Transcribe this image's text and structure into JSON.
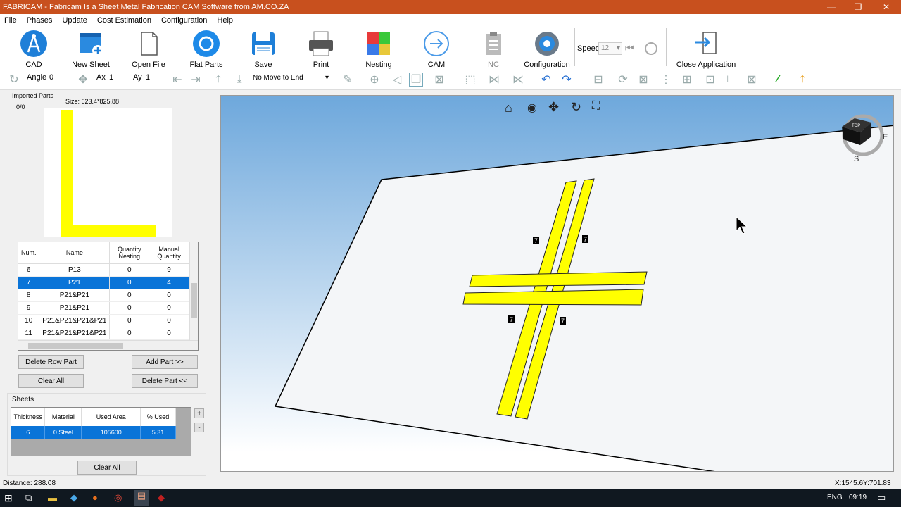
{
  "window": {
    "title": "FABRICAM - Fabricam Is a Sheet Metal Fabrication CAM Software from AM.CO.ZA"
  },
  "menu": [
    "File",
    "Phases",
    "Update",
    "Cost Estimation",
    "Configuration",
    "Help"
  ],
  "toolbar": {
    "cad": "CAD",
    "new_sheet": "New Sheet",
    "open_file": "Open File",
    "flat_parts": "Flat Parts",
    "save": "Save",
    "print": "Print",
    "nesting": "Nesting",
    "cam": "CAM",
    "nc": "NC",
    "configuration": "Configuration",
    "speed_label": "Speed",
    "speed_value": "12",
    "close_application": "Close Application"
  },
  "toolbar2": {
    "angle_label": "Angle",
    "angle_value": "0",
    "ax_label": "Ax",
    "ax_value": "1",
    "ay_label": "Ay",
    "ay_value": "1",
    "move_dropdown": "No Move to End"
  },
  "imported_parts": {
    "label": "Imported Parts",
    "count": "0/0",
    "size": "Size: 623.4*825.88"
  },
  "parts_table": {
    "headers": [
      "Num.",
      "Name",
      "Quantity Nesting",
      "Manual Quantity"
    ],
    "rows": [
      {
        "num": "6",
        "name": "P13",
        "qn": "0",
        "mq": "9"
      },
      {
        "num": "7",
        "name": "P21",
        "qn": "0",
        "mq": "4"
      },
      {
        "num": "8",
        "name": "P21&P21",
        "qn": "0",
        "mq": "0"
      },
      {
        "num": "9",
        "name": "P21&P21",
        "qn": "0",
        "mq": "0"
      },
      {
        "num": "10",
        "name": "P21&P21&P21&P21",
        "qn": "0",
        "mq": "0"
      },
      {
        "num": "11",
        "name": "P21&P21&P21&P21",
        "qn": "0",
        "mq": "0"
      }
    ],
    "selected_row": 1
  },
  "buttons": {
    "delete_row_part": "Delete Row Part",
    "add_part": "Add Part >>",
    "clear_all": "Clear All",
    "delete_part": "Delete Part <<",
    "sheets_clear_all": "Clear All",
    "plus": "+",
    "minus": "-"
  },
  "sheets": {
    "label": "Sheets",
    "headers": [
      "Thickness",
      "Material",
      "Used Area",
      "% Used"
    ],
    "row": {
      "thickness": "6",
      "material": "0  Steel",
      "used_area": "105600",
      "pct_used": "5.31"
    }
  },
  "viewport": {
    "part_labels": [
      "7",
      "7",
      "7",
      "7"
    ],
    "cube": {
      "top": "TOP",
      "east": "E",
      "south": "S"
    }
  },
  "status": {
    "distance": "Distance: 288.08",
    "coords": "X:1545.6Y:701.83"
  },
  "taskbar": {
    "lang": "ENG",
    "time": "09:19"
  },
  "colors": {
    "titlebar": "#c8501e",
    "selection": "#0a74d8",
    "part_yellow": "#ffff00"
  }
}
